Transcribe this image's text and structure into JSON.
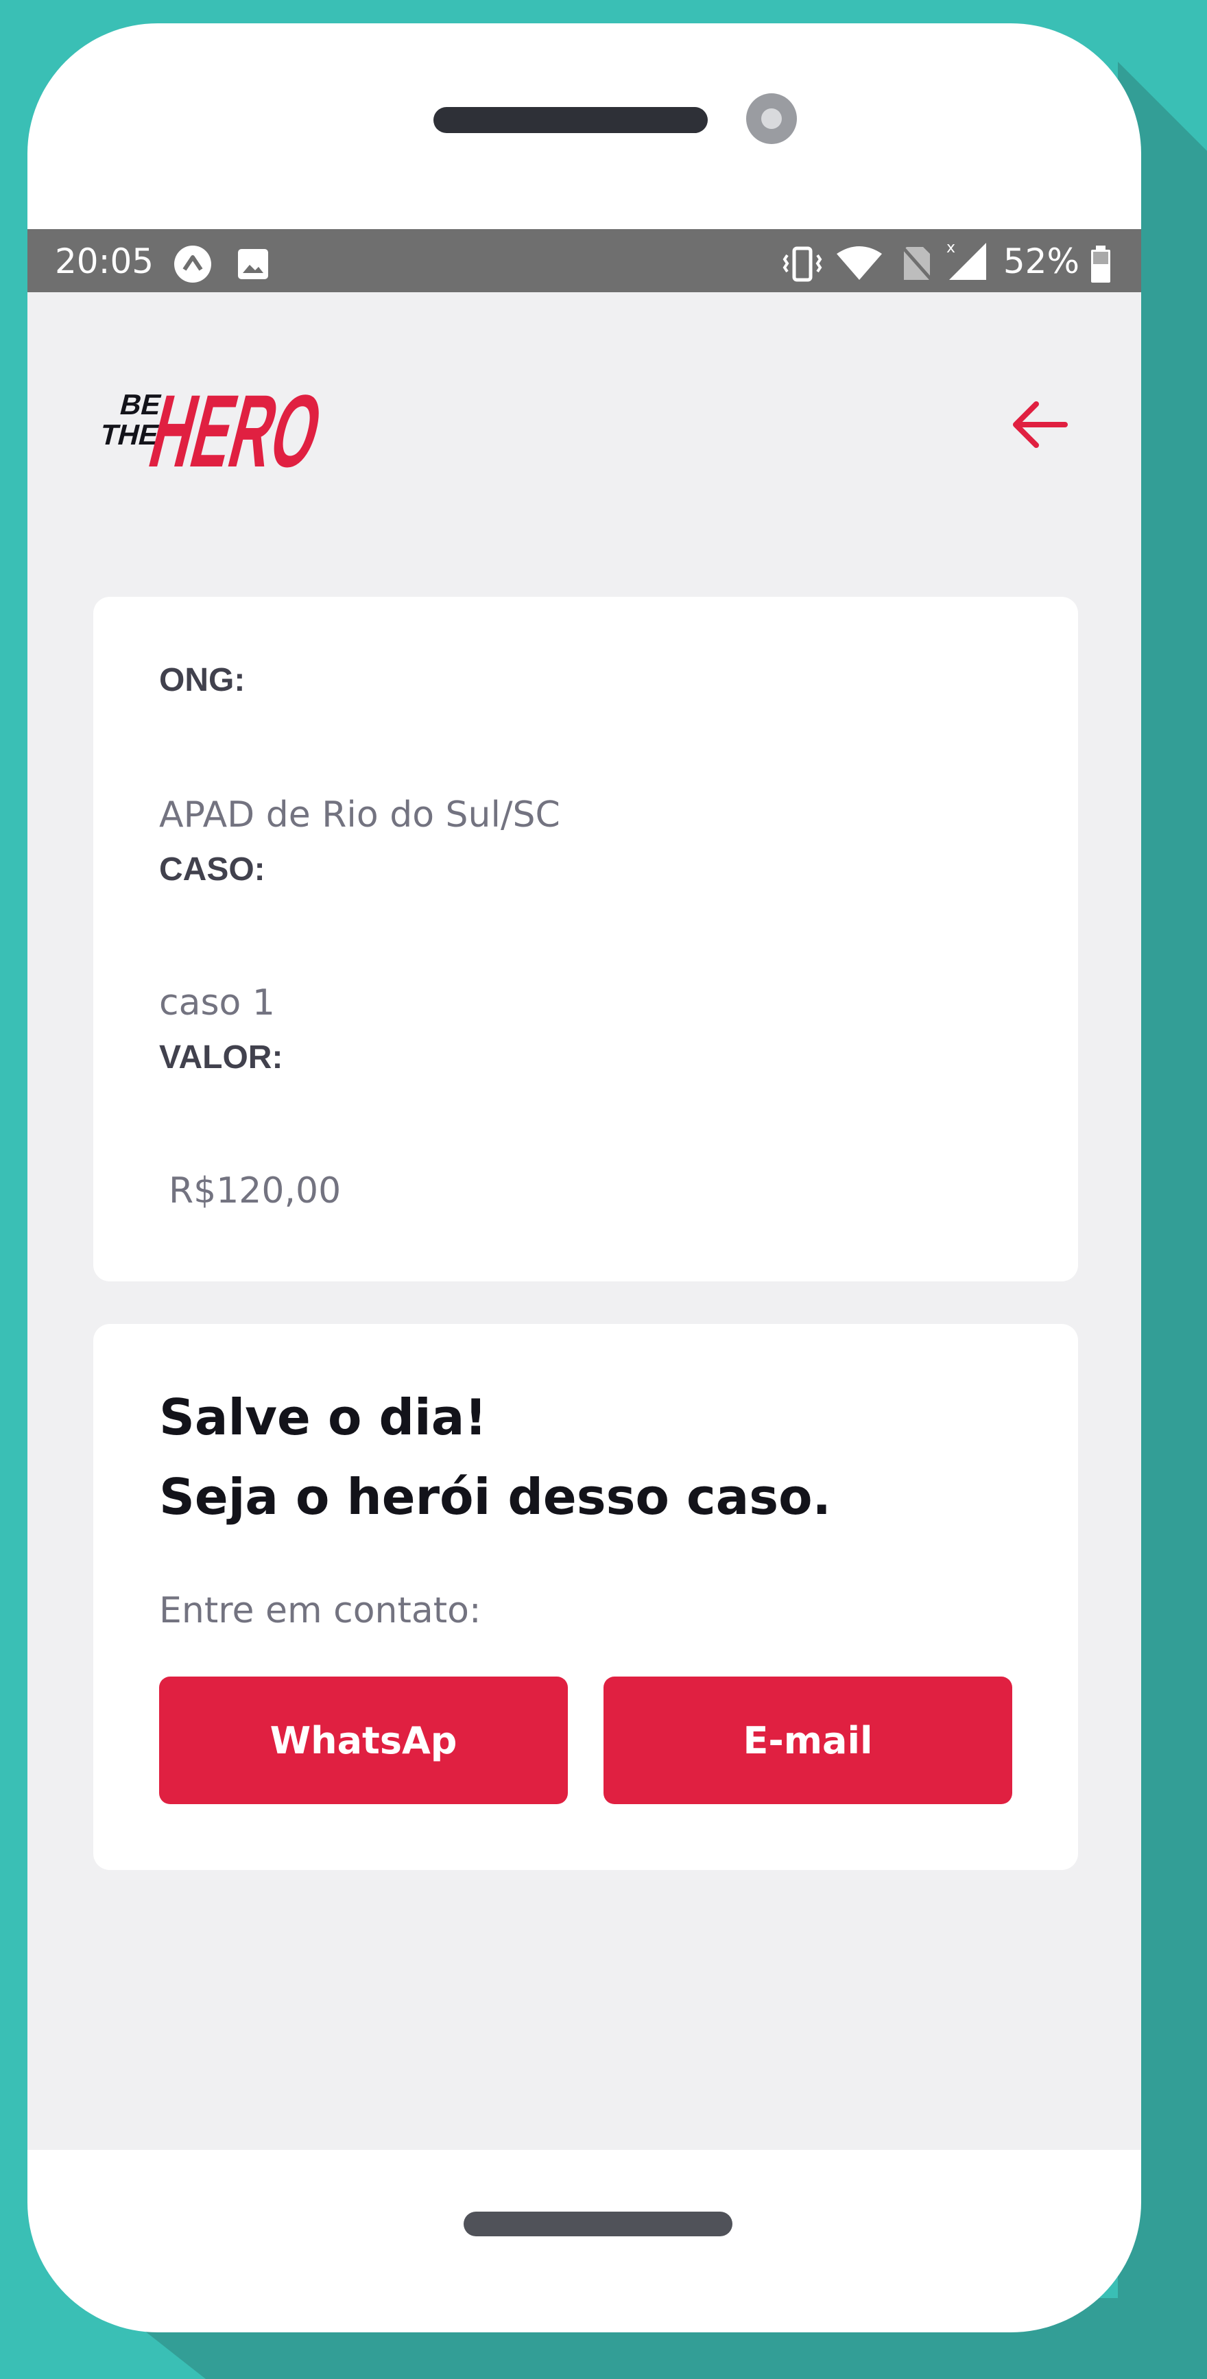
{
  "status_bar": {
    "time": "20:05",
    "battery_percent": "52%",
    "icons": [
      "app-notification-icon",
      "image-notification-icon",
      "vibrate-icon",
      "wifi-icon",
      "no-sim-icon",
      "signal-icon",
      "battery-icon"
    ]
  },
  "header": {
    "logo_text_small_1": "BE",
    "logo_text_small_2": "THE",
    "logo_text_big": "HERO",
    "back_icon": "arrow-left-icon"
  },
  "incident": {
    "ong_label": "ONG:",
    "ong_value": "APAD de Rio do Sul/SC",
    "case_label": "CASO:",
    "case_value": "caso 1",
    "value_label": "VALOR:",
    "value_value": "R$120,00"
  },
  "contact": {
    "title_line1": "Salve o dia!",
    "title_line2": "Seja o herói desso caso.",
    "subtitle": "Entre em contato:",
    "whatsapp_label": "WhatsAp",
    "email_label": "E-mail"
  },
  "colors": {
    "brand": "#e02041",
    "background": "#3abfb5",
    "screen_bg": "#f0f0f2"
  }
}
